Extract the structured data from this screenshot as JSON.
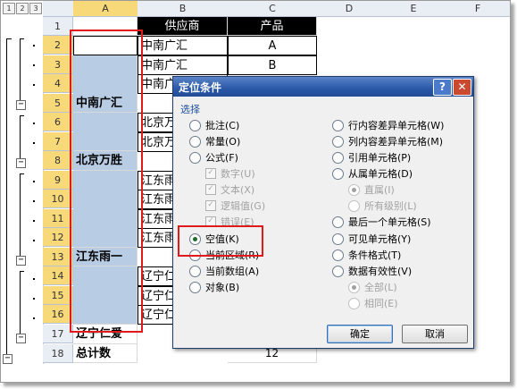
{
  "outline_levels": [
    "1",
    "2",
    "3"
  ],
  "columns": [
    "A",
    "B",
    "C",
    "D",
    "E",
    "F"
  ],
  "rows": [
    {
      "num": "1",
      "a": "",
      "b": "供应商",
      "c": "产品"
    },
    {
      "num": "2",
      "a": "",
      "b": "中南广汇",
      "c": "A"
    },
    {
      "num": "3",
      "a": "",
      "b": "中南广汇",
      "c": "B"
    },
    {
      "num": "4",
      "a": "",
      "b": "中南广",
      "c": ""
    },
    {
      "num": "5",
      "a": "中南广汇",
      "b": "",
      "c": ""
    },
    {
      "num": "6",
      "a": "",
      "b": "北京万",
      "c": ""
    },
    {
      "num": "7",
      "a": "",
      "b": "北京万",
      "c": ""
    },
    {
      "num": "8",
      "a": "北京万胜",
      "b": "",
      "c": ""
    },
    {
      "num": "9",
      "a": "",
      "b": "江东雨",
      "c": ""
    },
    {
      "num": "10",
      "a": "",
      "b": "江东雨",
      "c": ""
    },
    {
      "num": "11",
      "a": "",
      "b": "江东雨",
      "c": ""
    },
    {
      "num": "12",
      "a": "",
      "b": "江东雨",
      "c": ""
    },
    {
      "num": "13",
      "a": "江东雨一",
      "b": "",
      "c": ""
    },
    {
      "num": "14",
      "a": "",
      "b": "辽宁仁",
      "c": ""
    },
    {
      "num": "15",
      "a": "",
      "b": "辽宁仁",
      "c": ""
    },
    {
      "num": "16",
      "a": "",
      "b": "辽宁仁",
      "c": ""
    },
    {
      "num": "17",
      "a": "辽宁仁爱",
      "b": "",
      "c": ""
    },
    {
      "num": "18",
      "a": "总计数",
      "b": "",
      "c": "12"
    }
  ],
  "dialog": {
    "title": "定位条件",
    "help_label": "?",
    "close_label": "✕",
    "group_label": "选择",
    "left_options": [
      {
        "label": "批注(C)",
        "selected": false,
        "kind": "radio",
        "disabled": false
      },
      {
        "label": "常量(O)",
        "selected": false,
        "kind": "radio",
        "disabled": false
      },
      {
        "label": "公式(F)",
        "selected": false,
        "kind": "radio",
        "disabled": false
      },
      {
        "label": "数字(U)",
        "selected": true,
        "kind": "check",
        "disabled": true
      },
      {
        "label": "文本(X)",
        "selected": true,
        "kind": "check",
        "disabled": true
      },
      {
        "label": "逻辑值(G)",
        "selected": true,
        "kind": "check",
        "disabled": true
      },
      {
        "label": "错误(E)",
        "selected": true,
        "kind": "check",
        "disabled": true
      },
      {
        "label": "空值(K)",
        "selected": true,
        "kind": "radio",
        "disabled": false
      },
      {
        "label": "当前区域(R)",
        "selected": false,
        "kind": "radio",
        "disabled": false
      },
      {
        "label": "当前数组(A)",
        "selected": false,
        "kind": "radio",
        "disabled": false
      },
      {
        "label": "对象(B)",
        "selected": false,
        "kind": "radio",
        "disabled": false
      }
    ],
    "right_options": [
      {
        "label": "行内容差异单元格(W)",
        "selected": false,
        "kind": "radio",
        "disabled": false
      },
      {
        "label": "列内容差异单元格(M)",
        "selected": false,
        "kind": "radio",
        "disabled": false
      },
      {
        "label": "引用单元格(P)",
        "selected": false,
        "kind": "radio",
        "disabled": false
      },
      {
        "label": "从属单元格(D)",
        "selected": false,
        "kind": "radio",
        "disabled": false
      },
      {
        "label": "直属(I)",
        "selected": true,
        "kind": "radio",
        "disabled": true
      },
      {
        "label": "所有级别(L)",
        "selected": false,
        "kind": "radio",
        "disabled": true
      },
      {
        "label": "最后一个单元格(S)",
        "selected": false,
        "kind": "radio",
        "disabled": false
      },
      {
        "label": "可见单元格(Y)",
        "selected": false,
        "kind": "radio",
        "disabled": false
      },
      {
        "label": "条件格式(T)",
        "selected": false,
        "kind": "radio",
        "disabled": false
      },
      {
        "label": "数据有效性(V)",
        "selected": false,
        "kind": "radio",
        "disabled": false
      },
      {
        "label": "全部(L)",
        "selected": true,
        "kind": "radio",
        "disabled": true
      },
      {
        "label": "相同(E)",
        "selected": false,
        "kind": "radio",
        "disabled": true
      }
    ],
    "ok_label": "确定",
    "cancel_label": "取消"
  }
}
